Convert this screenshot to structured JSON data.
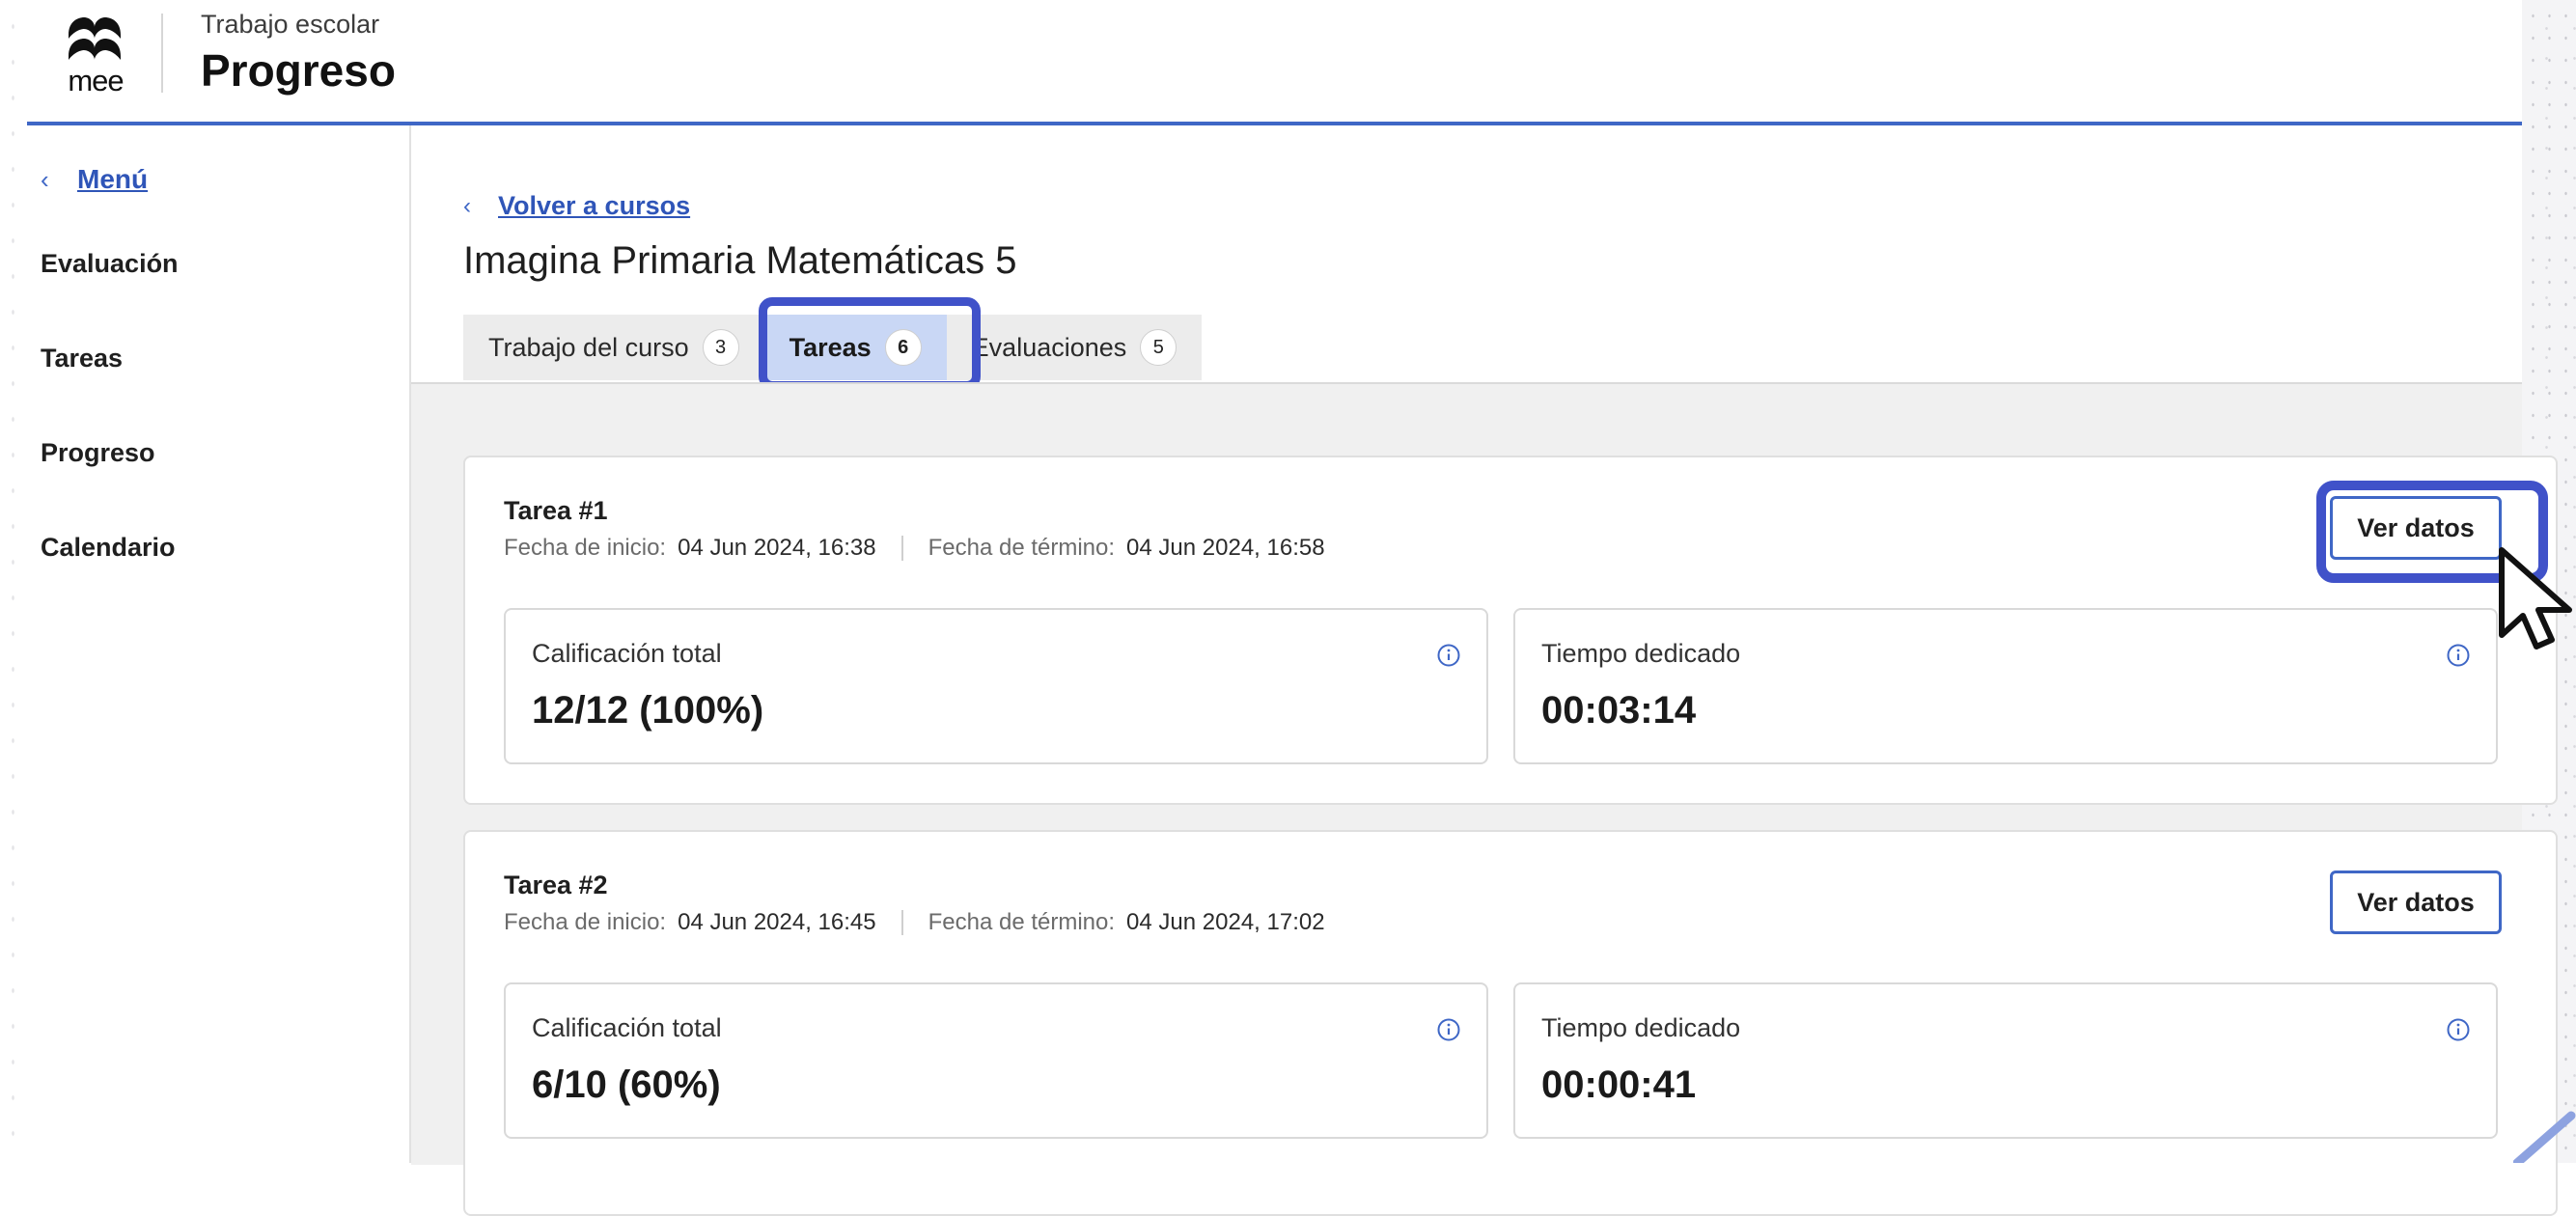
{
  "header": {
    "logo_text": "mee",
    "subtitle": "Trabajo escolar",
    "title": "Progreso"
  },
  "sidebar": {
    "back_label": "Menú",
    "items": [
      {
        "label": "Evaluación"
      },
      {
        "label": "Tareas"
      },
      {
        "label": "Progreso"
      },
      {
        "label": "Calendario"
      }
    ]
  },
  "main": {
    "back_label": "Volver a cursos",
    "course_title": "Imagina Primaria Matemáticas 5",
    "tabs": [
      {
        "label": "Trabajo del curso",
        "count": "3"
      },
      {
        "label": "Tareas",
        "count": "6",
        "active": true
      },
      {
        "label": "Evaluaciones",
        "count": "5"
      }
    ],
    "tasks": [
      {
        "title": "Tarea #1",
        "start_label": "Fecha de inicio:",
        "start_value": "04 Jun 2024, 16:38",
        "end_label": "Fecha de término:",
        "end_value": "04 Jun 2024, 16:58",
        "button_label": "Ver datos",
        "score_label": "Calificación total",
        "score_value": "12/12 (100%)",
        "time_label": "Tiempo dedicado",
        "time_value": "00:03:14"
      },
      {
        "title": "Tarea #2",
        "start_label": "Fecha de inicio:",
        "start_value": "04 Jun 2024, 16:45",
        "end_label": "Fecha de término:",
        "end_value": "04 Jun 2024, 17:02",
        "button_label": "Ver datos",
        "score_label": "Calificación total",
        "score_value": "6/10 (60%)",
        "time_label": "Tiempo dedicado",
        "time_value": "00:00:41"
      }
    ]
  },
  "colors": {
    "accent": "#3f67c6",
    "highlight": "#4052c9",
    "active_tab": "#c9d7f5"
  }
}
